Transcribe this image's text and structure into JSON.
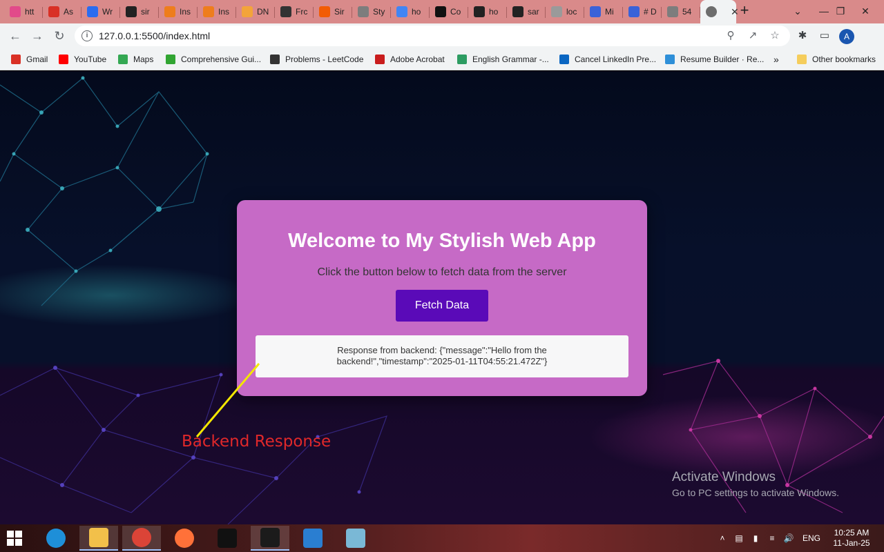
{
  "browser": {
    "tabs": [
      {
        "label": "htt",
        "icon": "pink-heart-icon",
        "color": "#e24a8a"
      },
      {
        "label": "As",
        "icon": "gmail-icon",
        "color": "#d93025"
      },
      {
        "label": "Wr",
        "icon": "blue-diamond-icon",
        "color": "#2b6cf0"
      },
      {
        "label": "sir",
        "icon": "github-icon",
        "color": "#222222"
      },
      {
        "label": "Ins",
        "icon": "orange-link-icon",
        "color": "#ee7d1c"
      },
      {
        "label": "Ins",
        "icon": "orange-link-icon",
        "color": "#ee7d1c"
      },
      {
        "label": "DN",
        "icon": "cloud-icon",
        "color": "#f3a43a"
      },
      {
        "label": "Frc",
        "icon": "openai-icon",
        "color": "#333333"
      },
      {
        "label": "Sir",
        "icon": "fire-icon",
        "color": "#f25c05"
      },
      {
        "label": "Sty",
        "icon": "globe-icon",
        "color": "#7d7d7d"
      },
      {
        "label": "ho",
        "icon": "google-icon",
        "color": "#4285f4"
      },
      {
        "label": "Co",
        "icon": "ab-icon",
        "color": "#111111"
      },
      {
        "label": "ho",
        "icon": "dark-circle-icon",
        "color": "#222222"
      },
      {
        "label": "sar",
        "icon": "github-icon",
        "color": "#222222"
      },
      {
        "label": "loc",
        "icon": "globe-icon",
        "color": "#9a9a9a"
      },
      {
        "label": "Mi",
        "icon": "calendar-icon",
        "color": "#3a62d8"
      },
      {
        "label": "# D",
        "icon": "calendar-icon",
        "color": "#3a62d8"
      },
      {
        "label": "54",
        "icon": "globe-icon",
        "color": "#7d7d7d"
      }
    ],
    "active_tab": {
      "label": "",
      "icon": "globe-icon"
    },
    "new_tab": "+",
    "window_controls": {
      "minimize": "—",
      "restore": "❐",
      "close": "✕",
      "tab_search": "⌄"
    },
    "url": "127.0.0.1:5500/index.html",
    "profile_initial": "A",
    "bookmarks": [
      {
        "label": "Gmail",
        "icon": "gmail-icon",
        "color": "#d93025"
      },
      {
        "label": "YouTube",
        "icon": "youtube-icon",
        "color": "#ff0000"
      },
      {
        "label": "Maps",
        "icon": "maps-pin-icon",
        "color": "#34a853"
      },
      {
        "label": "Comprehensive Gui...",
        "icon": "green-bolt-icon",
        "color": "#31a532"
      },
      {
        "label": "Problems - LeetCode",
        "icon": "leetcode-icon",
        "color": "#333333"
      },
      {
        "label": "Adobe Acrobat",
        "icon": "acrobat-icon",
        "color": "#c91d1d"
      },
      {
        "label": "English Grammar -...",
        "icon": "infinity-icon",
        "color": "#2d9c62"
      },
      {
        "label": "Cancel LinkedIn Pre...",
        "icon": "linkedin-icon",
        "color": "#0a66c2"
      },
      {
        "label": "Resume Builder · Re...",
        "icon": "resume-icon",
        "color": "#2e8fd8"
      }
    ],
    "bookmarks_overflow": "»",
    "other_bookmarks": "Other bookmarks"
  },
  "app": {
    "title": "Welcome to My Stylish Web App",
    "subtitle": "Click the button below to fetch data from the server",
    "button_label": "Fetch Data",
    "response_text": "Response from backend: {\"message\":\"Hello from the backend!\",\"timestamp\":\"2025-01-11T04:55:21.472Z\"}",
    "card_color": "#c66ac6",
    "button_color": "#5a0ab8"
  },
  "annotation": {
    "label": "Backend Response",
    "label_color": "#e0282a",
    "arrow_color": "#f3e600"
  },
  "watermark": {
    "line1": "Activate Windows",
    "line2": "Go to PC settings to activate Windows."
  },
  "taskbar": {
    "apps": [
      {
        "name": "edge-icon",
        "color": "#1e8fd8"
      },
      {
        "name": "file-explorer-icon",
        "color": "#f2c04a"
      },
      {
        "name": "chrome-icon",
        "color": "#db4437"
      },
      {
        "name": "firefox-icon",
        "color": "#ff7139"
      },
      {
        "name": "command-prompt-icon",
        "color": "#111111"
      },
      {
        "name": "terminal-app-icon",
        "color": "#1b1b1b"
      },
      {
        "name": "vscode-icon",
        "color": "#2a7ed1"
      },
      {
        "name": "notepad-icon",
        "color": "#7ab8d6"
      }
    ],
    "language": "ENG",
    "time": "10:25 AM",
    "date": "11-Jan-25"
  }
}
